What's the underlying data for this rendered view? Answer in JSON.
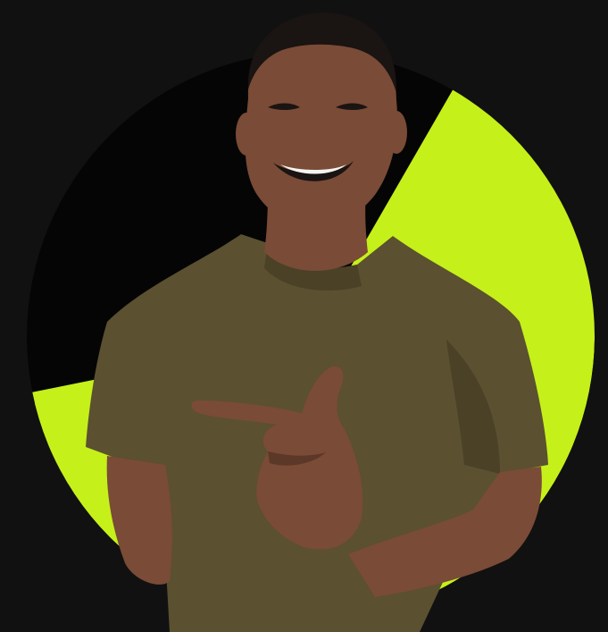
{
  "image": {
    "subject_icon": "smiling-person-pointing",
    "colors": {
      "page_background": "#111111",
      "dark_sector": "#050505",
      "accent_sector": "#c6f01a",
      "skin": "#7a4b36",
      "skin_shadow": "#5c3828",
      "hair": "#1a1412",
      "shirt": "#5b5030",
      "shirt_shadow": "#4a4127",
      "teeth": "#f5f5f0"
    }
  }
}
